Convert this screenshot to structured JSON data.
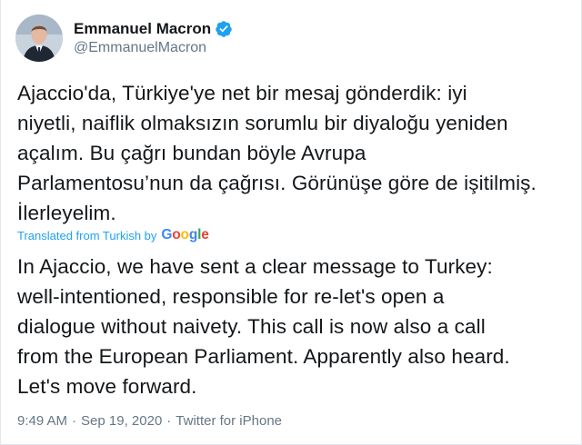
{
  "author": {
    "display_name": "Emmanuel Macron",
    "handle": "@EmmanuelMacron",
    "verified": true,
    "verified_icon": "verified-badge-icon",
    "avatar_icon": "profile-photo"
  },
  "tweet": {
    "text": "Ajaccio'da, Türkiye'ye net bir mesaj gönderdik: iyi\nniyetli, naiflik olmaksızın sorumlu bir diyaloğu yeniden\naçalım. Bu çağrı bundan böyle Avrupa\nParlamentosu’nun da çağrısı. Görünüşe göre de işitilmiş.\nİlerleyelim.",
    "translated_label": "Translated from Turkish by",
    "translation_provider": "Google",
    "translation": "In Ajaccio, we have sent a clear message to Turkey:\nwell-intentioned, responsible for re-let's open a\ndialogue without naivety. This call is now also a call\nfrom the European Parliament. Apparently also heard.\nLet's move forward."
  },
  "meta": {
    "time": "9:49 AM",
    "separator": "·",
    "date": "Sep 19, 2020",
    "source": "Twitter for iPhone"
  },
  "colors": {
    "link": "#1da1f2",
    "muted": "#657786",
    "text": "#14171a",
    "google_blue": "#4285f4",
    "google_red": "#ea4335",
    "google_yellow": "#fbbc05",
    "google_green": "#34a853"
  }
}
